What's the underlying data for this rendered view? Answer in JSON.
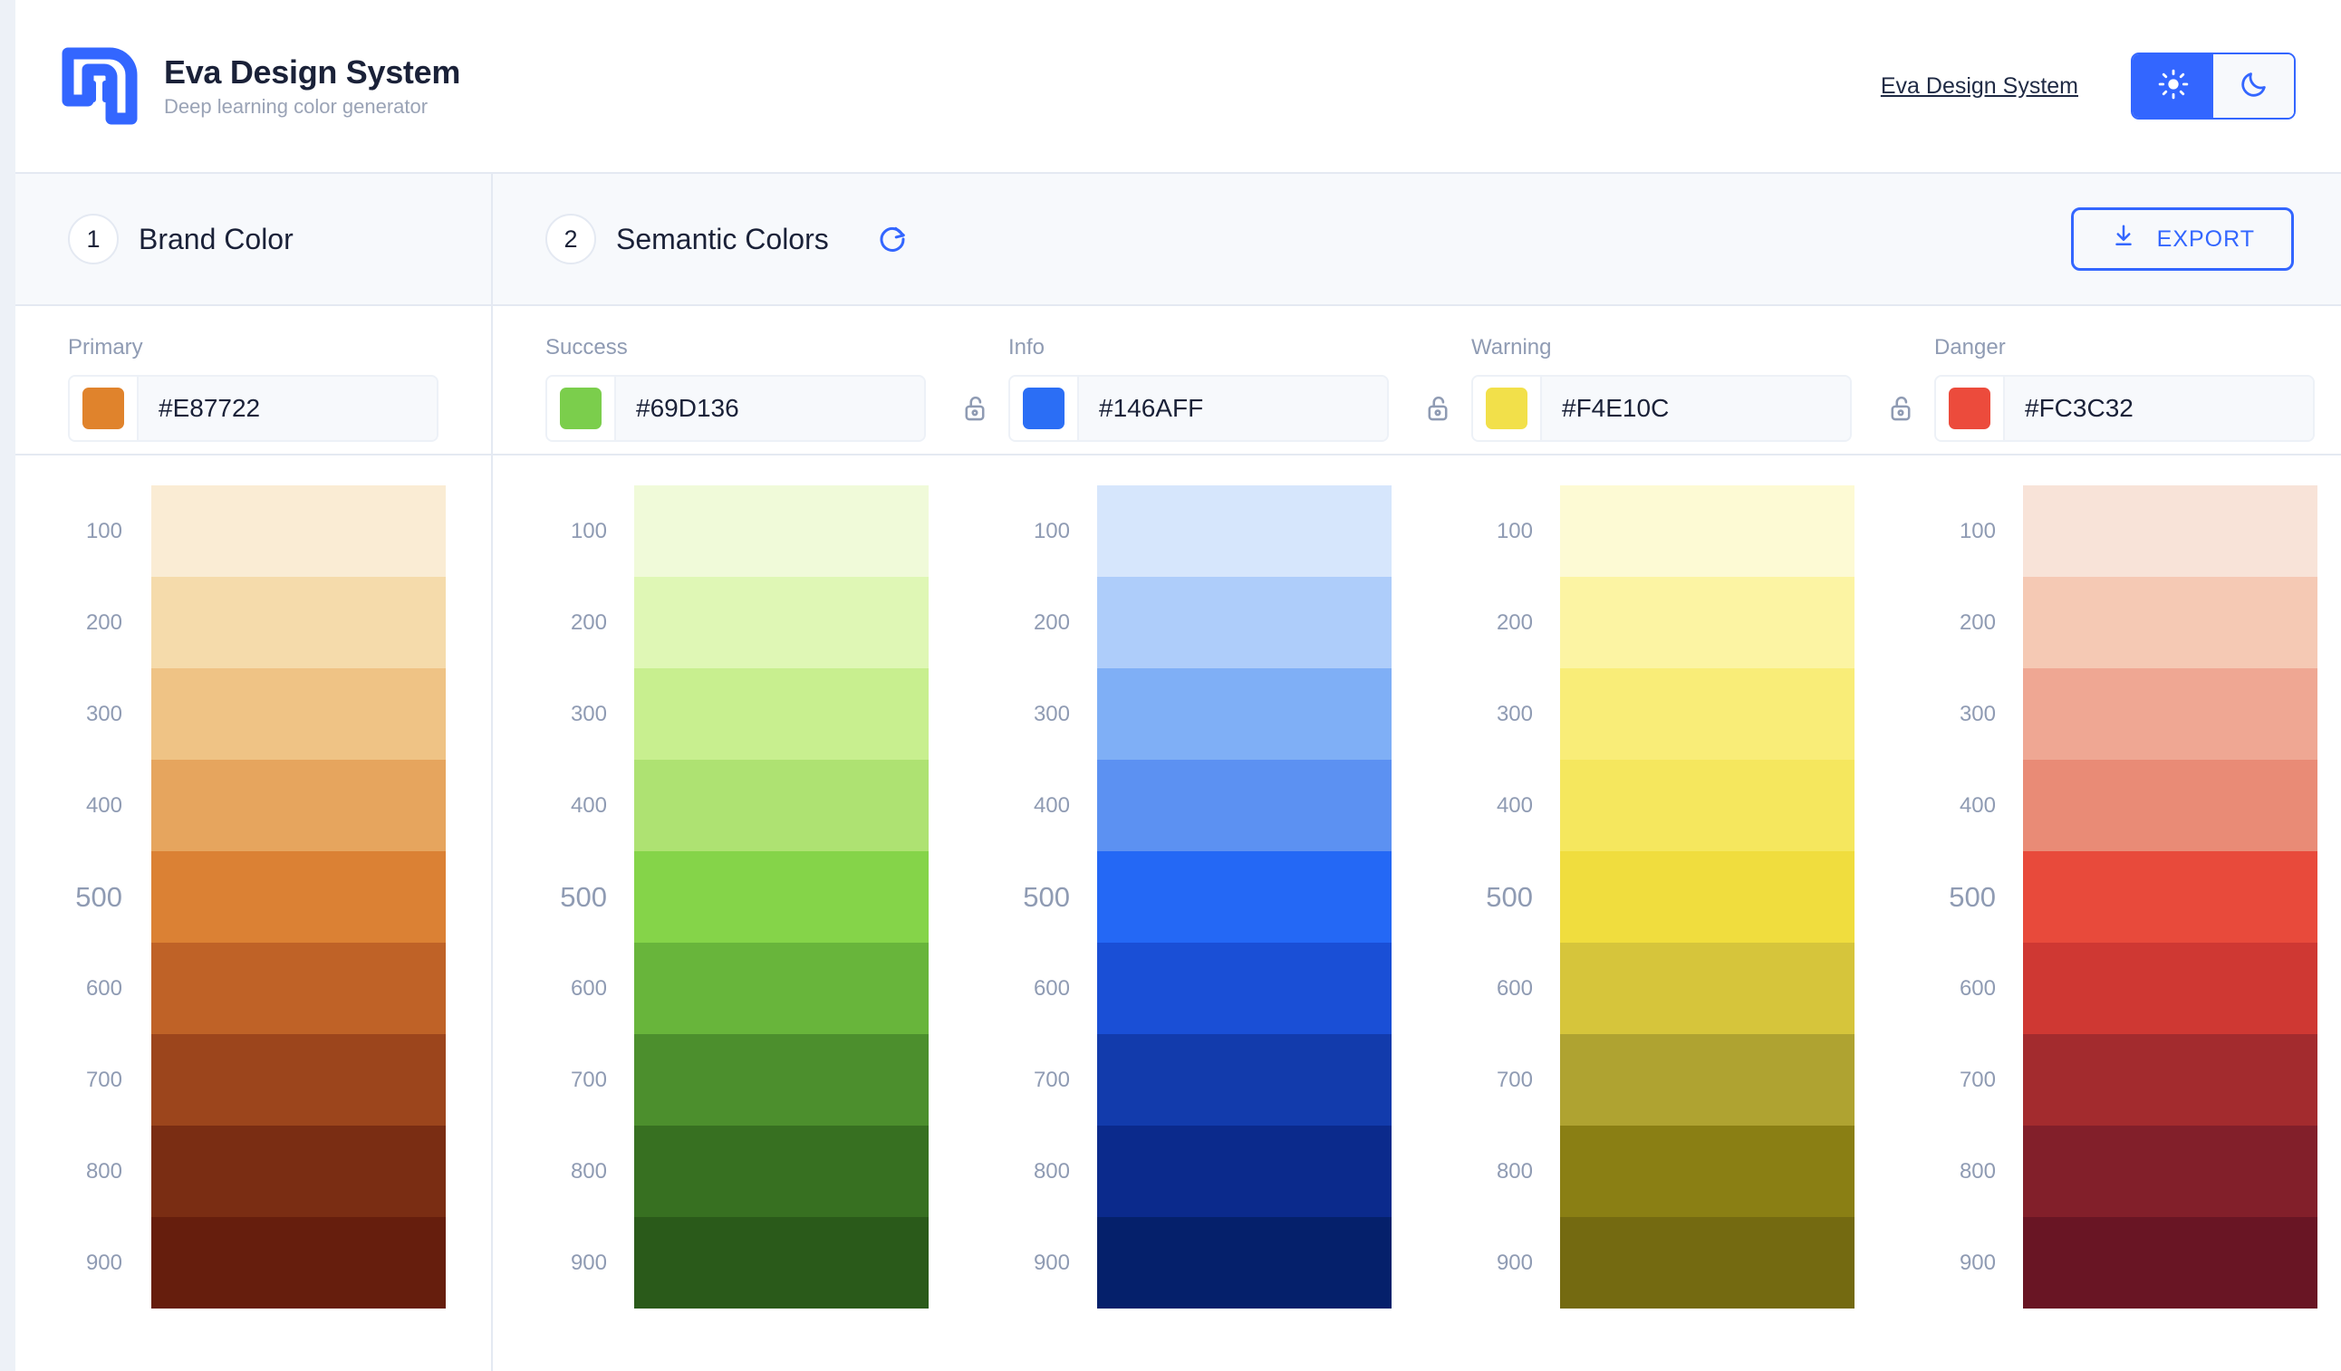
{
  "header": {
    "logo_icon": "eva-logo-icon",
    "title": "Eva Design System",
    "subtitle": "Deep learning color generator",
    "nav_link": "Eva Design System",
    "theme": {
      "light_icon": "sun-icon",
      "dark_icon": "moon-icon",
      "active": "light"
    }
  },
  "steps": {
    "brand": {
      "number": "1",
      "label": "Brand Color"
    },
    "semantic": {
      "number": "2",
      "label": "Semantic Colors",
      "refresh_icon": "refresh-icon"
    },
    "export": {
      "label": "EXPORT",
      "icon": "download-icon"
    }
  },
  "colors": {
    "accent": "#3366FF",
    "text_primary": "#1A2138",
    "text_muted": "#8F9BB3",
    "border": "#E4E9F2",
    "panel_bg": "#F7F9FC"
  },
  "inputs": {
    "primary": {
      "label": "Primary",
      "value": "#E87722",
      "swatch": "#E87722",
      "lockable": false
    },
    "semantic": [
      {
        "label": "Success",
        "value": "#69D136",
        "swatch": "#69D136",
        "lockable": true,
        "lock_icon": "unlock-icon"
      },
      {
        "label": "Info",
        "value": "#146AFF",
        "swatch": "#2B6EF5",
        "lockable": true,
        "lock_icon": "unlock-icon"
      },
      {
        "label": "Warning",
        "value": "#F4E10C",
        "swatch": "#F2E04A",
        "lockable": true,
        "lock_icon": "unlock-icon"
      },
      {
        "label": "Danger",
        "value": "#FC3C32",
        "swatch": "#EC4B3C",
        "lockable": true,
        "lock_icon": "unlock-icon"
      }
    ]
  },
  "chart_data": {
    "type": "table",
    "title": "Eva Design System color ramps",
    "shades": [
      "100",
      "200",
      "300",
      "400",
      "500",
      "600",
      "700",
      "800",
      "900"
    ],
    "highlight_shade": "500",
    "series": [
      {
        "name": "Primary",
        "base": "#E87722",
        "values": [
          "#FAECD4",
          "#F5DBAB",
          "#EFC385",
          "#E6A55E",
          "#DB8134",
          "#BF6227",
          "#9C451C",
          "#7A2D13",
          "#661E0D"
        ]
      },
      {
        "name": "Success",
        "base": "#69D136",
        "values": [
          "#F0FAD9",
          "#DFF7B5",
          "#C8EF8F",
          "#AEE272",
          "#85D449",
          "#68B53B",
          "#4C8F2D",
          "#377021",
          "#2A5A1A"
        ]
      },
      {
        "name": "Info",
        "base": "#146AFF",
        "values": [
          "#D6E6FC",
          "#AECDFA",
          "#7FAFF6",
          "#5C91F2",
          "#2468F5",
          "#1A4FD6",
          "#123BAC",
          "#0B2A8C",
          "#05206B"
        ]
      },
      {
        "name": "Warning",
        "base": "#F4E10C",
        "values": [
          "#FDFAD4",
          "#FCF4A3",
          "#F9ED78",
          "#F5E75E",
          "#F0DD3E",
          "#D6C53B",
          "#AFA331",
          "#8A7F14",
          "#746A11"
        ]
      },
      {
        "name": "Danger",
        "base": "#FC3C32",
        "values": [
          "#F8E3D8",
          "#F5C9B4",
          "#EFA793",
          "#E98B76",
          "#E84A3B",
          "#CF3833",
          "#A32B2E",
          "#821F2A",
          "#691524"
        ]
      }
    ]
  }
}
